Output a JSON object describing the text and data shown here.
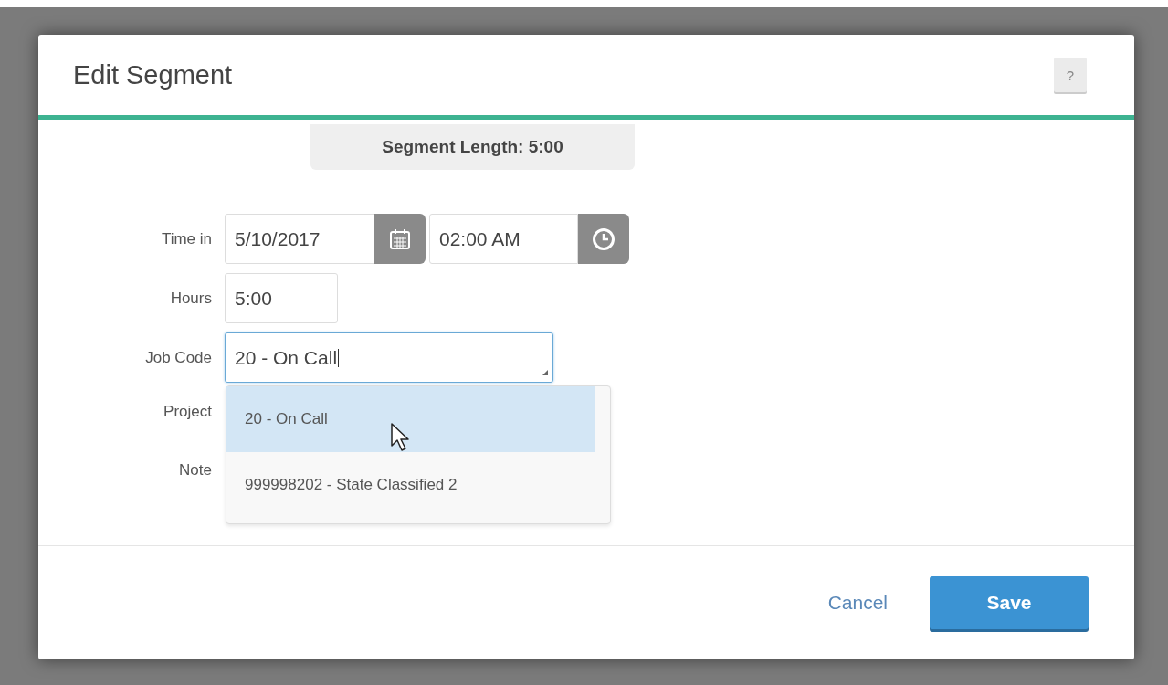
{
  "dialog": {
    "title": "Edit Segment",
    "help_button": "?",
    "segment_length": "Segment Length: 5:00",
    "fields": [
      {
        "kind": "datetime",
        "label": "Time in",
        "date": "5/10/2017",
        "time": "02:00 AM"
      },
      {
        "kind": "text",
        "label": "Hours",
        "value": "5:00"
      },
      {
        "kind": "combo",
        "label": "Job Code",
        "value": "20 - On Call",
        "focused": true
      },
      {
        "kind": "covered",
        "label": "Project"
      },
      {
        "kind": "covered",
        "label": "Note"
      }
    ],
    "dropdown": [
      {
        "label": "20 - On Call",
        "selected": true
      },
      {
        "label": "999998202 - State Classified 2",
        "selected": false
      }
    ],
    "buttons": [
      {
        "kind": "link",
        "label": "Cancel"
      },
      {
        "kind": "primary",
        "label": "Save"
      }
    ]
  }
}
